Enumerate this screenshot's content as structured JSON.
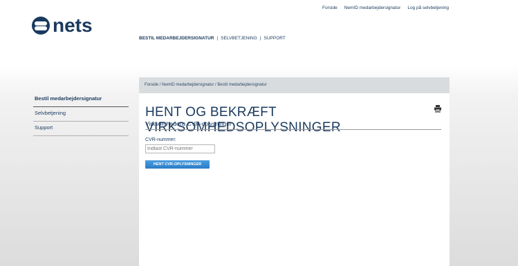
{
  "brand": {
    "logo_text": "nets",
    "color": "#1a3a5e"
  },
  "util_nav": [
    "Forside",
    "NemID medarbejdersignatur",
    "Log på selvbetjening"
  ],
  "main_nav": {
    "items": [
      "BESTIL MEDARBEJDERSIGNATUR",
      "SELVBETJENING",
      "SUPPORT"
    ],
    "separator": "|"
  },
  "sidebar": {
    "items": [
      {
        "label": "Bestil medarbejdersignatur"
      },
      {
        "label": "Selvbetjening"
      },
      {
        "label": "Support"
      }
    ]
  },
  "breadcrumb": "Forside / NemID medarbejdersignatur / Bestil medarbejdersignatur",
  "page": {
    "title": "HENT OG BEKRÆFT VIRKSOMHEDSOPLYSNINGER",
    "subtitle": "Virksomhedens CVR-oplysninger",
    "cvr_label": "CVR-nummer:",
    "cvr_placeholder": "Indtast CVR-nummer",
    "button_label": "HENT CVR-OPLYSNINGER"
  },
  "icons": {
    "print": "printer-icon"
  },
  "colors": {
    "accent": "#2b7cc6",
    "breadcrumb_bg": "#d9dcde"
  }
}
